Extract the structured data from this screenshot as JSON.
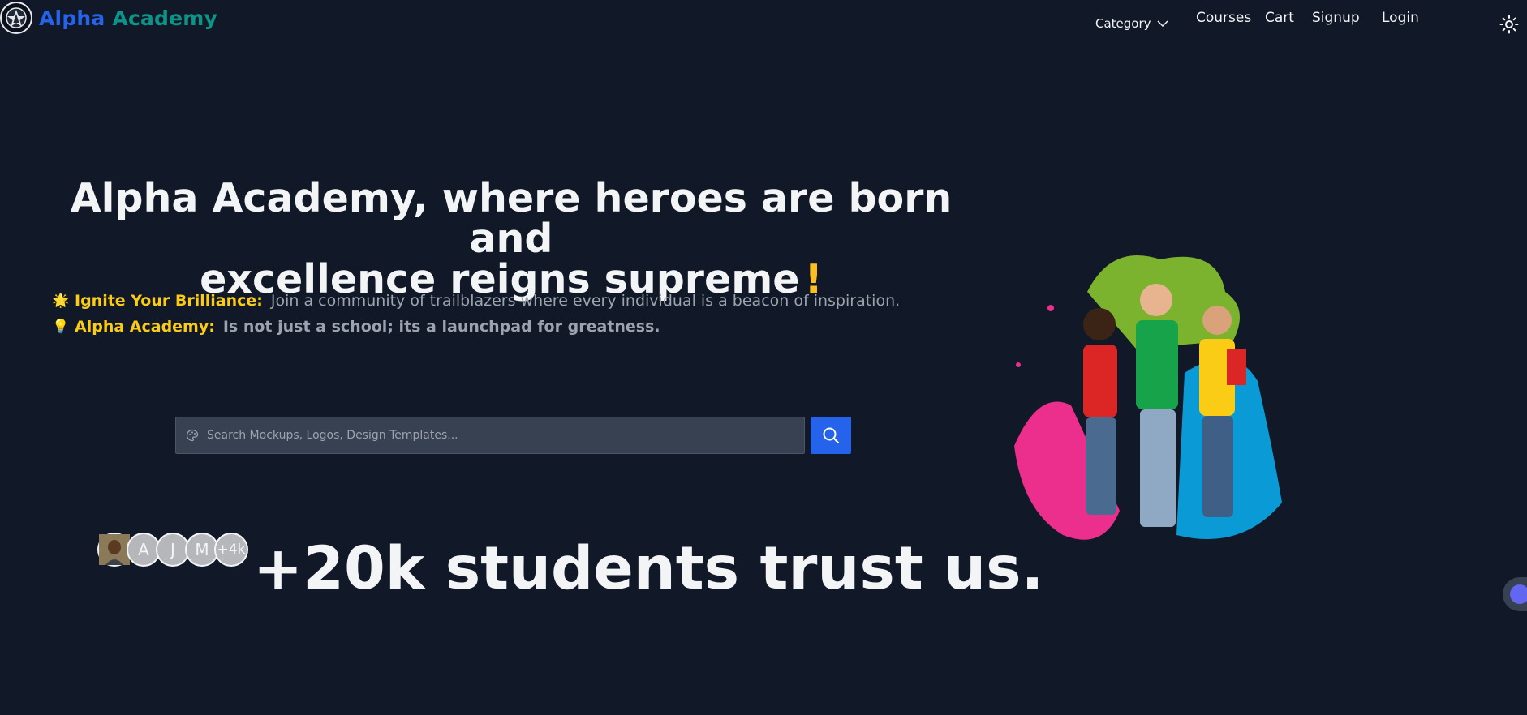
{
  "brand": {
    "name_part1": "Alpha",
    "name_part2": "Academy"
  },
  "nav": {
    "category": "Category",
    "courses": "Courses",
    "cart": "Cart",
    "signup": "Signup",
    "login": "Login"
  },
  "hero": {
    "title_line1": "Alpha Academy, where heroes are born and",
    "title_line2": "excellence reigns supreme",
    "title_excl": "!",
    "taglines": [
      {
        "emoji": "🌟",
        "strong": "Ignite Your Brilliance:",
        "text": "Join a community of trailblazers where every individual is a beacon of inspiration."
      },
      {
        "emoji": "💡",
        "strong": "Alpha Academy:",
        "text": "Is not just a school; its a launchpad for greatness."
      }
    ]
  },
  "search": {
    "placeholder": "Search Mockups, Logos, Design Templates..."
  },
  "trust": {
    "avatars": [
      "",
      "A",
      "J",
      "M",
      "+4k"
    ],
    "text": "+20k students trust us."
  },
  "colors": {
    "background": "#111827",
    "brand_blue": "#2563eb",
    "brand_teal": "#0d9488",
    "accent_yellow": "#facc15",
    "search_bg": "#374151"
  },
  "icons": {
    "theme": "sun-icon",
    "search": "search-icon",
    "search_field": "palette-icon",
    "category_toggle": "chevron-down-icon",
    "chat": "chat-icon"
  }
}
